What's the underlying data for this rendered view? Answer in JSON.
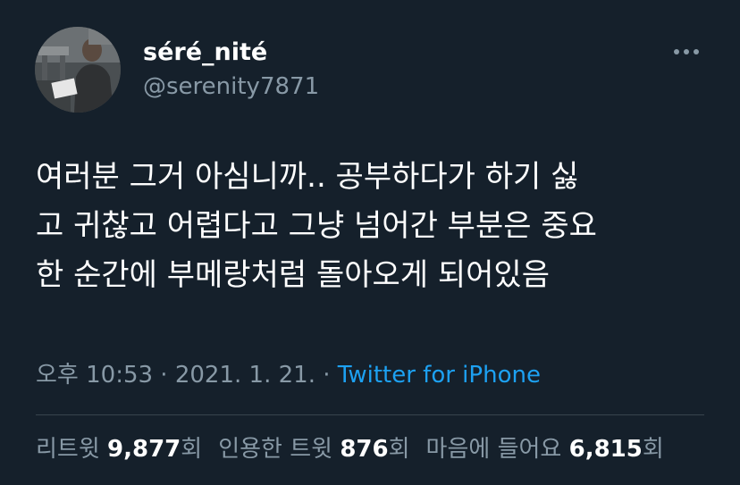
{
  "user": {
    "display_name": "séré_nité",
    "handle": "@serenity7871"
  },
  "tweet": {
    "text": "여러분 그거 아심니까.. 공부하다가 하기 싫\n고 귀찮고 어렵다고 그냥 넘어간 부분은 중요\n한 순간에 부메랑처럼 돌아오게 되어있음",
    "time": "오후 10:53",
    "sep1": " · ",
    "date": "2021. 1. 21.",
    "sep2": " · ",
    "source": "Twitter for iPhone"
  },
  "stats": {
    "retweets_label": "리트윗 ",
    "retweets_count": "9,877",
    "retweets_suffix": "회",
    "quotes_label": "인용한 트윗 ",
    "quotes_count": "876",
    "quotes_suffix": "회",
    "likes_label": "마음에 들어요 ",
    "likes_count": "6,815",
    "likes_suffix": "회"
  },
  "icons": {
    "more": "more-horizontal-icon",
    "avatar": "profile-photo"
  },
  "colors": {
    "background": "#15202b",
    "secondary_text": "#8899a6",
    "link": "#1da1f2",
    "divider": "#38444d"
  }
}
